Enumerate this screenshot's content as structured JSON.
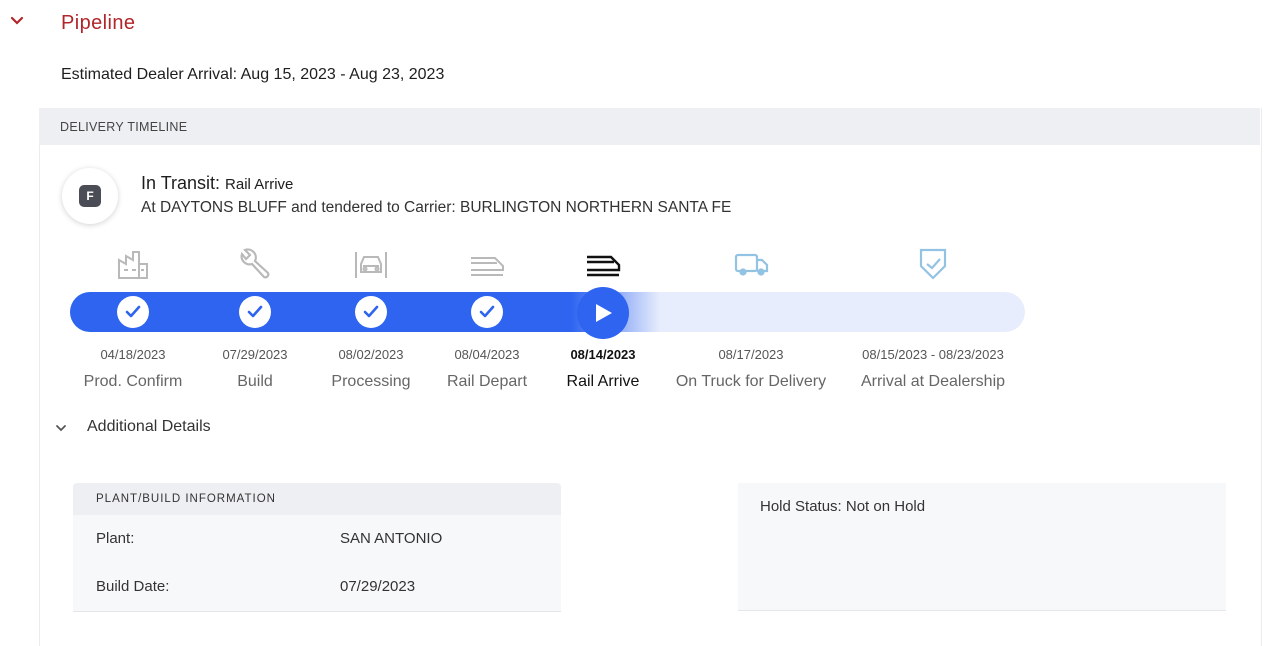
{
  "section": {
    "title": "Pipeline",
    "eta": "Estimated Dealer Arrival: Aug 15, 2023 - Aug 23, 2023",
    "accent_color": "#b1262b"
  },
  "timeline": {
    "header": "DELIVERY TIMELINE",
    "status_badge": "F",
    "status_title": "In Transit:",
    "status_subtitle": "Rail Arrive",
    "status_desc": "At DAYTONS BLUFF and tendered to Carrier: BURLINGTON NORTHERN SANTA FE",
    "progress_color": "#2e64f0",
    "steps": [
      {
        "date": "04/18/2023",
        "label": "Prod. Confirm",
        "icon": "factory-icon",
        "state": "done"
      },
      {
        "date": "07/29/2023",
        "label": "Build",
        "icon": "wrench-icon",
        "state": "done"
      },
      {
        "date": "08/02/2023",
        "label": "Processing",
        "icon": "car-processing-icon",
        "state": "done"
      },
      {
        "date": "08/04/2023",
        "label": "Rail Depart",
        "icon": "train-depart-icon",
        "state": "done"
      },
      {
        "date": "08/14/2023",
        "label": "Rail Arrive",
        "icon": "train-arrive-icon",
        "state": "current"
      },
      {
        "date": "08/17/2023",
        "label": "On Truck for Delivery",
        "icon": "truck-icon",
        "state": "pending"
      },
      {
        "date": "08/15/2023 - 08/23/2023",
        "label": "Arrival at Dealership",
        "icon": "shield-check-icon",
        "state": "pending"
      }
    ]
  },
  "additional": {
    "label": "Additional Details",
    "plant_header": "PLANT/BUILD INFORMATION",
    "rows": [
      {
        "key": "Plant:",
        "value": "SAN ANTONIO"
      },
      {
        "key": "Build Date:",
        "value": "07/29/2023"
      }
    ],
    "hold_status": "Hold Status: Not on Hold"
  }
}
